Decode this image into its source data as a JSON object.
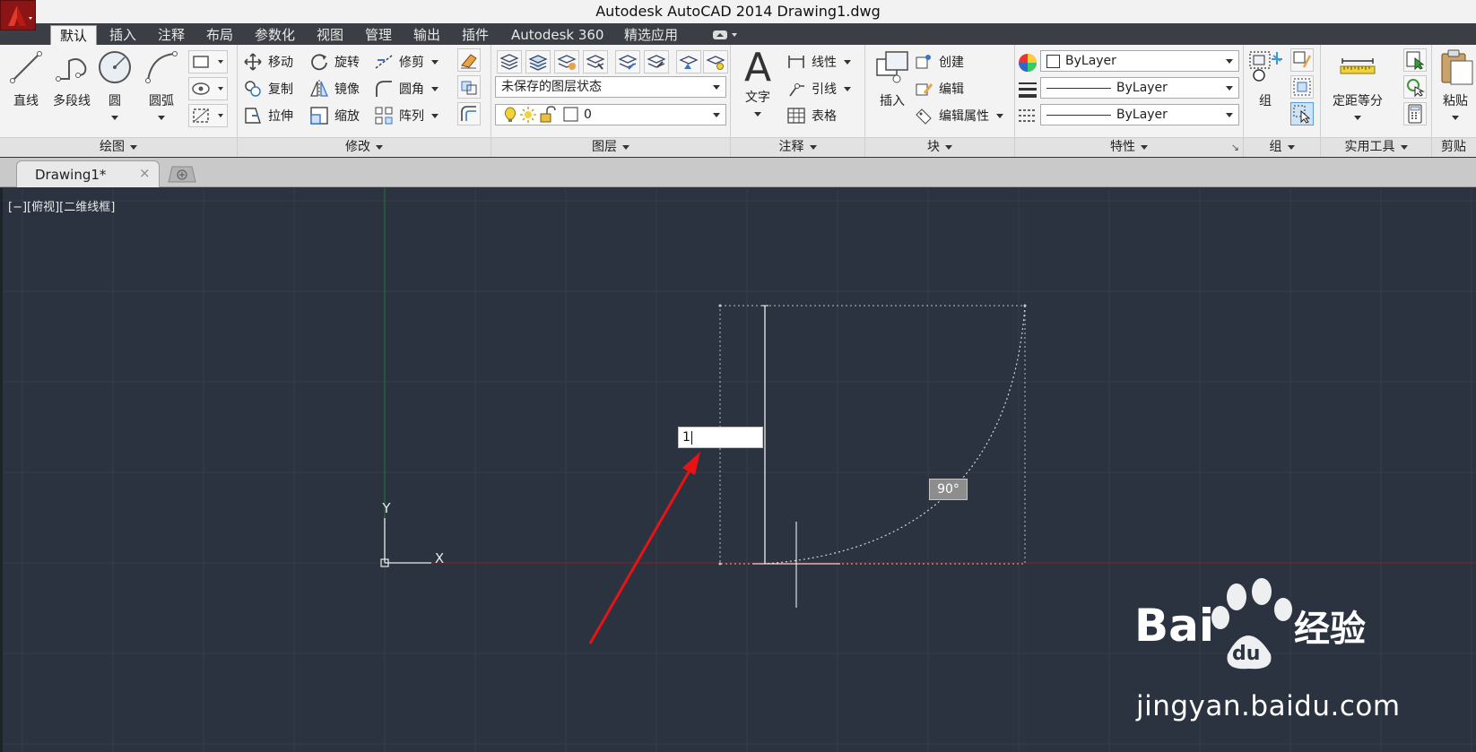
{
  "window": {
    "title": "Autodesk AutoCAD 2014    Drawing1.dwg"
  },
  "ribbon_tabs": [
    {
      "label": "默认",
      "active": true
    },
    {
      "label": "插入"
    },
    {
      "label": "注释"
    },
    {
      "label": "布局"
    },
    {
      "label": "参数化"
    },
    {
      "label": "视图"
    },
    {
      "label": "管理"
    },
    {
      "label": "输出"
    },
    {
      "label": "插件"
    },
    {
      "label": "Autodesk 360"
    },
    {
      "label": "精选应用"
    }
  ],
  "panels": {
    "draw": {
      "title": "绘图",
      "line": "直线",
      "polyline": "多段线",
      "circle": "圆",
      "arc": "圆弧"
    },
    "modify": {
      "title": "修改",
      "move": "移动",
      "rotate": "旋转",
      "trim": "修剪",
      "copy": "复制",
      "mirror": "镜像",
      "fillet": "圆角",
      "stretch": "拉伸",
      "scale": "缩放",
      "array": "阵列"
    },
    "layers": {
      "title": "图层",
      "layer_state": "未保存的图层状态",
      "current_layer": "0"
    },
    "annotation": {
      "title": "注释",
      "text": "文字",
      "linear": "线性",
      "leader": "引线",
      "table": "表格"
    },
    "block": {
      "title": "块",
      "insert": "插入",
      "create": "创建",
      "edit": "编辑",
      "edit_attributes": "编辑属性"
    },
    "properties": {
      "title": "特性",
      "color": "ByLayer",
      "linetype": "ByLayer",
      "lineweight": "ByLayer"
    },
    "groups": {
      "title": "组",
      "group": "组"
    },
    "utilities": {
      "title": "实用工具",
      "measure": "定距等分"
    },
    "clipboard": {
      "title": "剪贴",
      "paste": "粘贴"
    }
  },
  "document_tab": {
    "label": "Drawing1*",
    "close": "×"
  },
  "viewport": {
    "label": "[−][俯视][二维线框]",
    "ucs_x": "X",
    "ucs_y": "Y",
    "dynamic_input": "1",
    "angle_tooltip": "90°"
  },
  "watermark": {
    "text": "jingyan.baidu.com",
    "brand_latin": "Bai",
    "brand_du": "du",
    "brand_cn": "经验"
  },
  "colors": {
    "canvas": "#2b3340",
    "grid": "#343d4a",
    "x_axis": "#8a2020",
    "y_axis": "#1f7a2a",
    "arrow": "#e81414",
    "ribbon_bg": "#f3f3f3"
  }
}
